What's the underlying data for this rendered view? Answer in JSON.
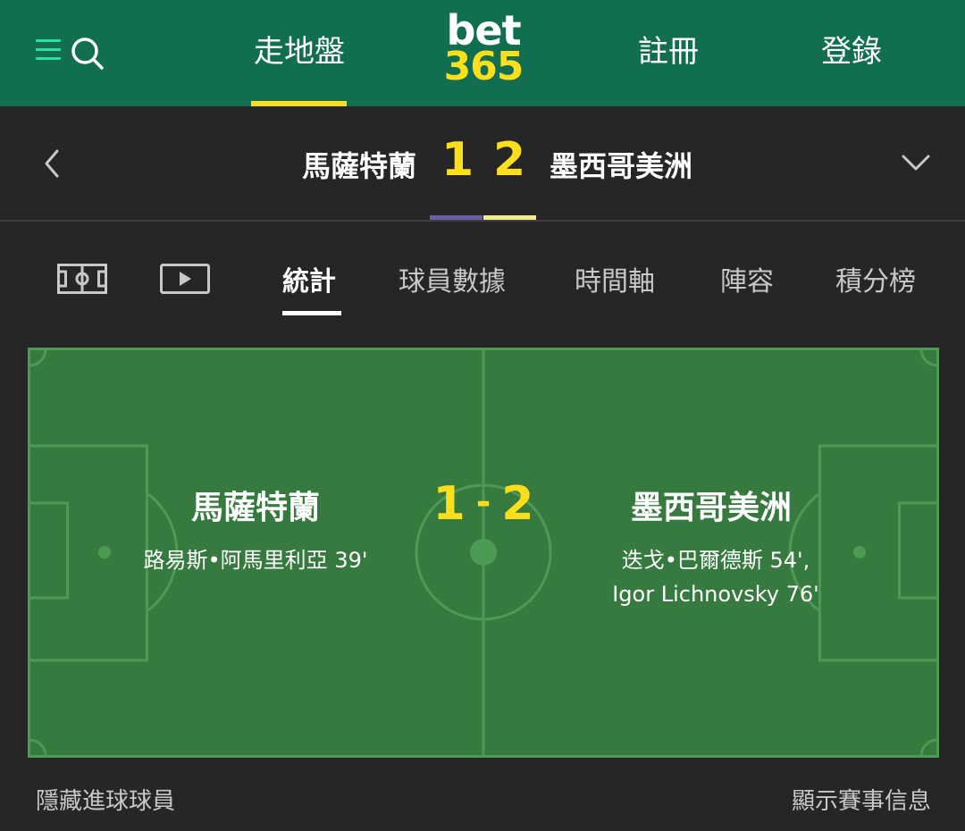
{
  "header": {
    "nav": {
      "inplay": "走地盤",
      "register": "註冊",
      "login": "登錄"
    },
    "logo": {
      "top": "bet",
      "bottom": "365"
    },
    "colors": {
      "bar": "#126e51",
      "accent": "#ffdf1b",
      "menu": "#26e2a0"
    }
  },
  "match": {
    "home_team": "馬薩特蘭",
    "away_team": "墨西哥美洲",
    "home_score": "1",
    "away_score": "2",
    "home_kit_color": "#6b5ea8",
    "away_kit_color": "#f3ec8c"
  },
  "tabs": {
    "icons": [
      "pitch-icon",
      "video-icon"
    ],
    "stats": "統計",
    "player_stats": "球員數據",
    "timeline": "時間軸",
    "lineup": "陣容",
    "standings": "積分榜",
    "active": "統計"
  },
  "pitch": {
    "home_team": "馬薩特蘭",
    "away_team": "墨西哥美洲",
    "home_score": "1",
    "separator": "-",
    "away_score": "2",
    "home_scorers": "路易斯•阿馬里利亞 39'",
    "away_scorers_line1": "迭戈•巴爾德斯 54',",
    "away_scorers_line2": "Igor Lichnovsky 76'",
    "color": "#367a3f"
  },
  "footer": {
    "hide_scorers": "隱藏進球球員",
    "show_match_info": "顯示賽事信息"
  }
}
